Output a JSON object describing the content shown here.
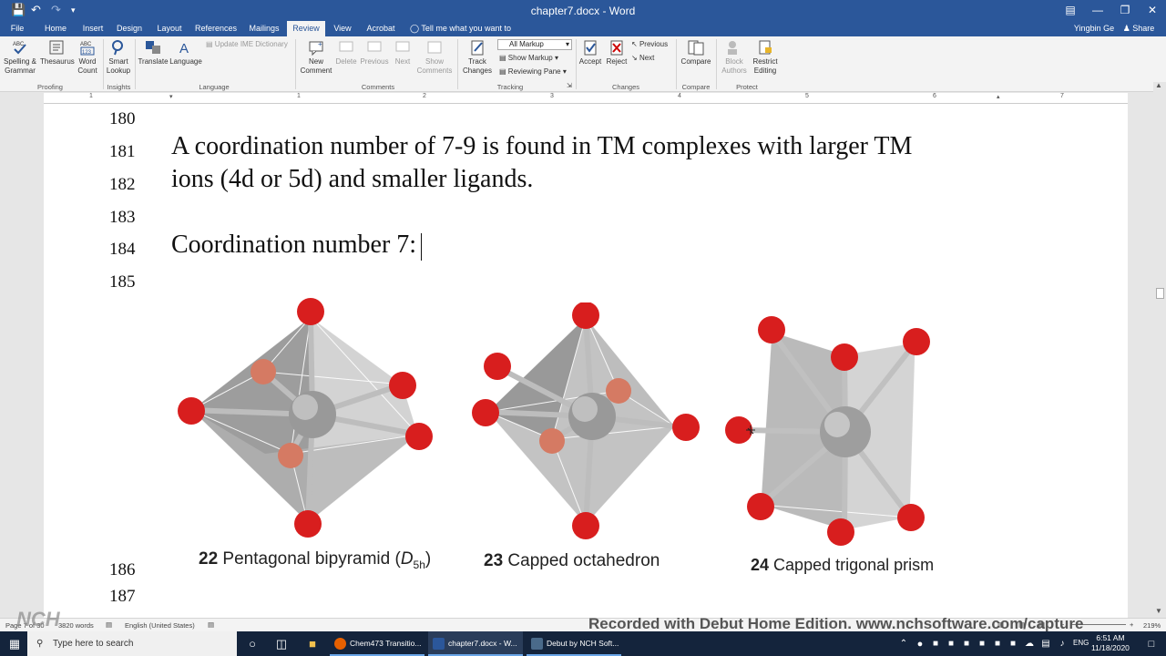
{
  "title_bar": {
    "document_title": "chapter7.docx - Word",
    "user_name": "Yingbin Ge",
    "share_label": "Share"
  },
  "tabs": [
    "File",
    "Home",
    "Insert",
    "Design",
    "Layout",
    "References",
    "Mailings",
    "Review",
    "View",
    "Acrobat"
  ],
  "active_tab": "Review",
  "tell_me": "Tell me what you want to do...",
  "ribbon": {
    "proofing": {
      "spelling": "Spelling &",
      "grammar": "Grammar",
      "thesaurus": "Thesaurus",
      "word_count_1": "Word",
      "word_count_2": "Count",
      "label": "Proofing"
    },
    "insights": {
      "smart_1": "Smart",
      "smart_2": "Lookup",
      "label": "Insights"
    },
    "language": {
      "translate": "Translate",
      "language": "Language",
      "update_ime": "Update IME Dictionary",
      "label": "Language"
    },
    "comments": {
      "new_1": "New",
      "new_2": "Comment",
      "delete": "Delete",
      "previous": "Previous",
      "next": "Next",
      "show_1": "Show",
      "show_2": "Comments",
      "label": "Comments"
    },
    "tracking": {
      "track_1": "Track",
      "track_2": "Changes",
      "all_markup": "All Markup",
      "show_markup": "Show Markup",
      "reviewing_pane": "Reviewing Pane",
      "label": "Tracking"
    },
    "changes": {
      "accept": "Accept",
      "reject": "Reject",
      "previous": "Previous",
      "next": "Next",
      "label": "Changes"
    },
    "compare": {
      "compare": "Compare",
      "label": "Compare"
    },
    "protect": {
      "block_1": "Block",
      "block_2": "Authors",
      "restrict_1": "Restrict",
      "restrict_2": "Editing",
      "label": "Protect"
    }
  },
  "ruler_numbers": [
    "1",
    "1",
    "2",
    "3",
    "4",
    "5",
    "6",
    "7"
  ],
  "document": {
    "line_numbers": [
      "180",
      "181",
      "182",
      "183",
      "184",
      "185",
      "186",
      "187"
    ],
    "line_181": "A coordination number of 7-9 is found in TM complexes with larger TM",
    "line_182": "ions (4d or 5d) and smaller ligands.",
    "line_184": "Coordination number 7:",
    "figures": [
      {
        "number": "22",
        "name": "Pentagonal bipyramid (",
        "sym": "D",
        "sub": "5h",
        "close": ")"
      },
      {
        "number": "23",
        "name": "Capped octahedron"
      },
      {
        "number": "24",
        "name": "Capped trigonal prism"
      }
    ]
  },
  "status_bar": {
    "page": "Page 7 of 30",
    "words": "3820 words",
    "language": "English (United States)",
    "zoom": "219%"
  },
  "watermark": "Recorded with Debut Home Edition. www.nchsoftware.com/capture",
  "taskbar": {
    "search_placeholder": "Type here to search",
    "apps": [
      "Chem473 Transitio...",
      "chapter7.docx - W...",
      "Debut by NCH Soft..."
    ],
    "lang": "ENG",
    "time": "6:51 AM",
    "date": "11/18/2020"
  },
  "colors": {
    "word_blue": "#2b579a",
    "atom_red": "#d81e1e",
    "taskbar": "#14243c"
  }
}
